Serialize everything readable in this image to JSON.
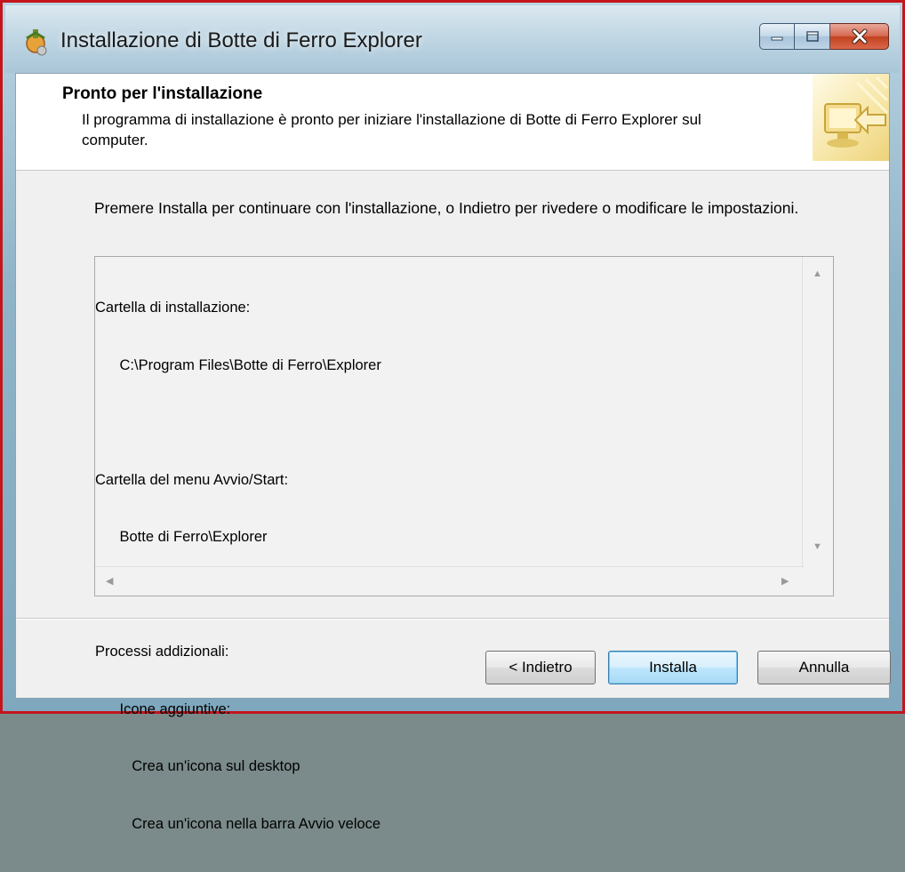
{
  "window": {
    "title": "Installazione di Botte di Ferro Explorer",
    "accent_color": "#c4151c"
  },
  "header": {
    "title": "Pronto per l'installazione",
    "subtitle": "Il programma di installazione è pronto per iniziare l'installazione di Botte di Ferro Explorer sul computer."
  },
  "body": {
    "intro": "Premere Installa per continuare con l'installazione, o Indietro per rivedere o modificare le impostazioni."
  },
  "memo": {
    "lines": [
      "Cartella di installazione:",
      "      C:\\Program Files\\Botte di Ferro\\Explorer",
      "",
      "Cartella del menu Avvio/Start:",
      "      Botte di Ferro\\Explorer",
      "",
      "Processi addizionali:",
      "      Icone aggiuntive:",
      "         Crea un'icona sul desktop",
      "         Crea un'icona nella barra Avvio veloce"
    ]
  },
  "buttons": {
    "back": "< Indietro",
    "install": "Installa",
    "cancel": "Annulla"
  },
  "icons": {
    "app": "installer-icon",
    "minimize": "minimize-icon",
    "maximize": "maximize-icon",
    "close": "close-icon",
    "header_graphic": "computer-install-arrow-icon"
  }
}
